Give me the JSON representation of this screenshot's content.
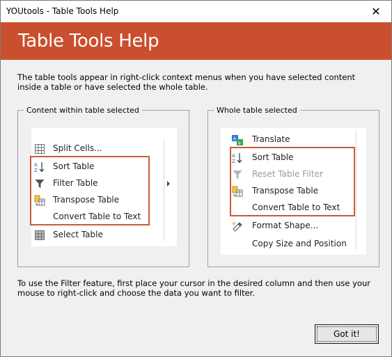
{
  "window": {
    "title": "YOUtools - Table Tools Help",
    "close_glyph": "✕"
  },
  "header": {
    "title": "Table Tools Help",
    "accent": "#c94f2e"
  },
  "intro_text": "The table tools appear in right-click context menus when you have selected content inside a table or have selected the whole table.",
  "left_group": {
    "label": "Content within table selected",
    "items": [
      {
        "label": "Split Cells...",
        "icon": "split-cells-icon"
      },
      {
        "label": "Sort Table",
        "icon": "sort-az-icon"
      },
      {
        "label": "Filter Table",
        "icon": "filter-icon",
        "submenu": true
      },
      {
        "label": "Transpose Table",
        "icon": "transpose-icon"
      },
      {
        "label": "Convert Table to Text",
        "icon": ""
      },
      {
        "label": "Select Table",
        "icon": "select-table-icon"
      }
    ]
  },
  "right_group": {
    "label": "Whole table selected",
    "items": [
      {
        "label": "Translate",
        "icon": "translate-icon"
      },
      {
        "label": "Sort Table",
        "icon": "sort-az-icon"
      },
      {
        "label": "Reset Table Filter",
        "icon": "filter-icon",
        "disabled": true
      },
      {
        "label": "Transpose Table",
        "icon": "transpose-icon"
      },
      {
        "label": "Convert Table to Text",
        "icon": ""
      },
      {
        "label": "Format Shape...",
        "icon": "format-shape-icon"
      },
      {
        "label": "Copy Size and Position",
        "icon": ""
      }
    ]
  },
  "footnote": "To use the Filter feature, first place your cursor in the desired column and then use your mouse to right-click and choose the data you want to filter.",
  "button": {
    "label": "Got it!"
  }
}
